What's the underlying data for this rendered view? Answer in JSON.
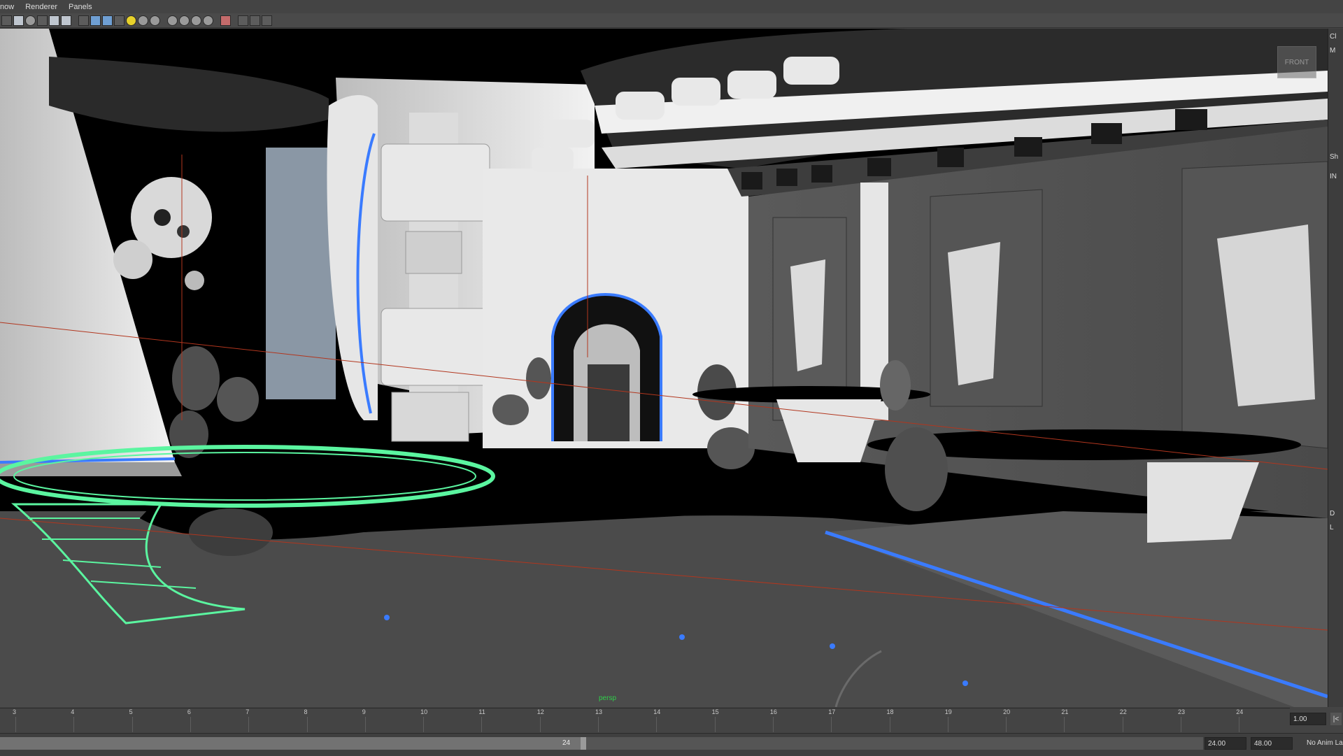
{
  "menu": {
    "items": [
      "now",
      "Renderer",
      "Panels"
    ]
  },
  "toolbar": {
    "icons": [
      "grid-icon",
      "camera-icon",
      "circle-icon",
      "cross-icon",
      "image-icon",
      "texture-icon",
      "wireframe-cube-icon",
      "shaded-cube-icon",
      "smooth-cube-icon",
      "checker-icon",
      "light-icon",
      "sphere-icon",
      "sphere-icon",
      "sphere-icon",
      "sphere-icon",
      "sphere-icon",
      "sphere-icon",
      "isolate-icon",
      "xray-icon",
      "gate-icon",
      "share-icon"
    ]
  },
  "viewport": {
    "camera_label": "persp",
    "view_cube_label": "FRONT"
  },
  "right_panel": {
    "labels": [
      "Cl",
      "M",
      "Sh",
      "IN",
      "D",
      "L"
    ]
  },
  "timeline": {
    "ticks": [
      "3",
      "4",
      "5",
      "6",
      "7",
      "8",
      "9",
      "10",
      "11",
      "12",
      "13",
      "14",
      "15",
      "16",
      "17",
      "18",
      "19",
      "20",
      "21",
      "22",
      "23",
      "24"
    ],
    "current_frame": "1.00"
  },
  "range": {
    "handle_label": "24",
    "start_value": "24.00",
    "end_value": "48.00",
    "anim_layer": "No Anim La"
  },
  "colors": {
    "accent_blue": "#3a7bff",
    "selection_green": "#5bf5a0",
    "timeline_bg": "#444444"
  }
}
